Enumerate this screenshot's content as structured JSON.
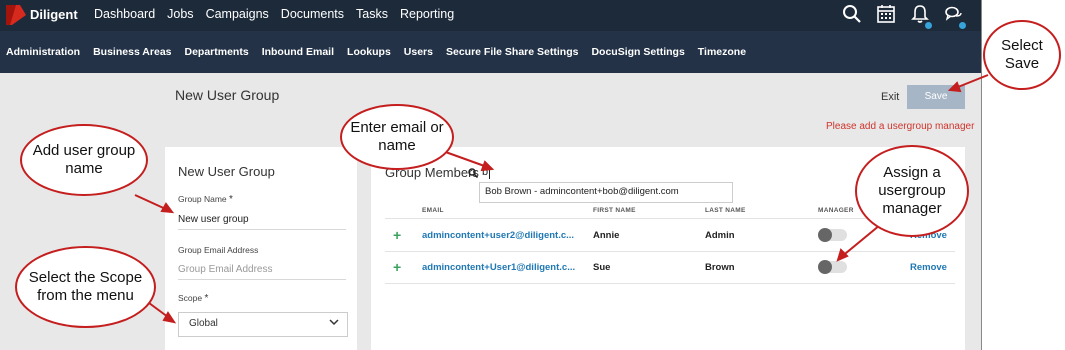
{
  "app": {
    "brand": "Diligent"
  },
  "top_nav": [
    "Dashboard",
    "Jobs",
    "Campaigns",
    "Documents",
    "Tasks",
    "Reporting"
  ],
  "sub_nav": [
    "Administration",
    "Business Areas",
    "Departments",
    "Inbound Email",
    "Lookups",
    "Users",
    "Secure File Share Settings",
    "DocuSign Settings",
    "Timezone"
  ],
  "page": {
    "title": "New User Group",
    "exit_label": "Exit",
    "save_label": "Save",
    "warning": "Please add a usergroup manager"
  },
  "left_card": {
    "title": "New User Group",
    "group_name_label": "Group Name",
    "group_name_value": "New user group",
    "group_email_label": "Group Email Address",
    "group_email_placeholder": "Group Email Address",
    "scope_label": "Scope",
    "scope_value": "Global",
    "required_mark": "*"
  },
  "members": {
    "title": "Group Members",
    "search_value": "b",
    "suggestion": "Bob Brown - admincontent+bob@diligent.com",
    "columns": [
      "EMAIL",
      "FIRST NAME",
      "LAST NAME",
      "MANAGER"
    ],
    "rows": [
      {
        "email": "admincontent+user2@diligent.c...",
        "first": "Annie",
        "last": "Admin",
        "manager": false,
        "action": "Remove"
      },
      {
        "email": "admincontent+User1@diligent.c...",
        "first": "Sue",
        "last": "Brown",
        "manager": false,
        "action": "Remove"
      }
    ]
  },
  "callouts": {
    "add_name": "Add user group name",
    "scope": "Select the Scope from the menu",
    "email": "Enter email or name",
    "manager": "Assign a usergroup manager",
    "save": "Select Save"
  },
  "colors": {
    "topbar": "#1d2a3a",
    "subbar": "#233247",
    "link": "#1f78b4",
    "warning": "#d0342c",
    "callout_border": "#c41e1e",
    "save_button": "#a7b6c6"
  },
  "icons": [
    "search-icon",
    "calendar-icon",
    "bell-icon",
    "chat-icon",
    "chevron-down-icon",
    "plus-icon"
  ]
}
